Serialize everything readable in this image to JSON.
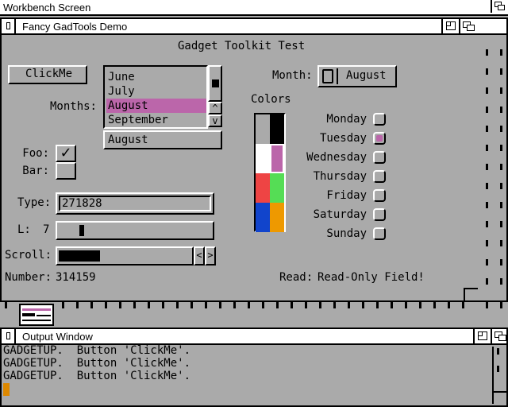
{
  "screen": {
    "title": "Workbench Screen"
  },
  "main_window": {
    "title": "Fancy GadTools Demo",
    "heading": "Gadget Toolkit Test",
    "clickme_label": "ClickMe",
    "months_label": "Months:",
    "months_list": [
      "June",
      "July",
      "August",
      "September"
    ],
    "months_selected": "August",
    "month_cycle_label": "Month:",
    "month_cycle_value": "August",
    "colors_label": "Colors",
    "palette": [
      "#000000",
      "#ffffff",
      "#bb66aa",
      "#ee4444",
      "#55dd55",
      "#1144cc",
      "#ee9900",
      "#aaaaaa"
    ],
    "palette_selected_index": 2,
    "foo_label": "Foo:",
    "foo_checked": true,
    "foo_check_glyph": "✓",
    "bar_label": "Bar:",
    "bar_checked": false,
    "type_label": "Type:",
    "type_value": "271828",
    "level_label": "L:",
    "level_value": "7",
    "scroll_label": "Scroll:",
    "scroll_left_glyph": "<",
    "scroll_right_glyph": ">",
    "number_label": "Number:",
    "number_value": "314159",
    "read_label": "Read:",
    "read_value": "Read-Only Field!",
    "days": [
      "Monday",
      "Tuesday",
      "Wednesday",
      "Thursday",
      "Friday",
      "Saturday",
      "Sunday"
    ],
    "days_selected": "Tuesday",
    "list_arrow_up": "^",
    "list_arrow_down": "v"
  },
  "output_window": {
    "title": "Output Window",
    "lines": [
      "GADGETUP.  Button 'ClickMe'.",
      "GADGETUP.  Button 'ClickMe'.",
      "GADGETUP.  Button 'ClickMe'."
    ]
  }
}
